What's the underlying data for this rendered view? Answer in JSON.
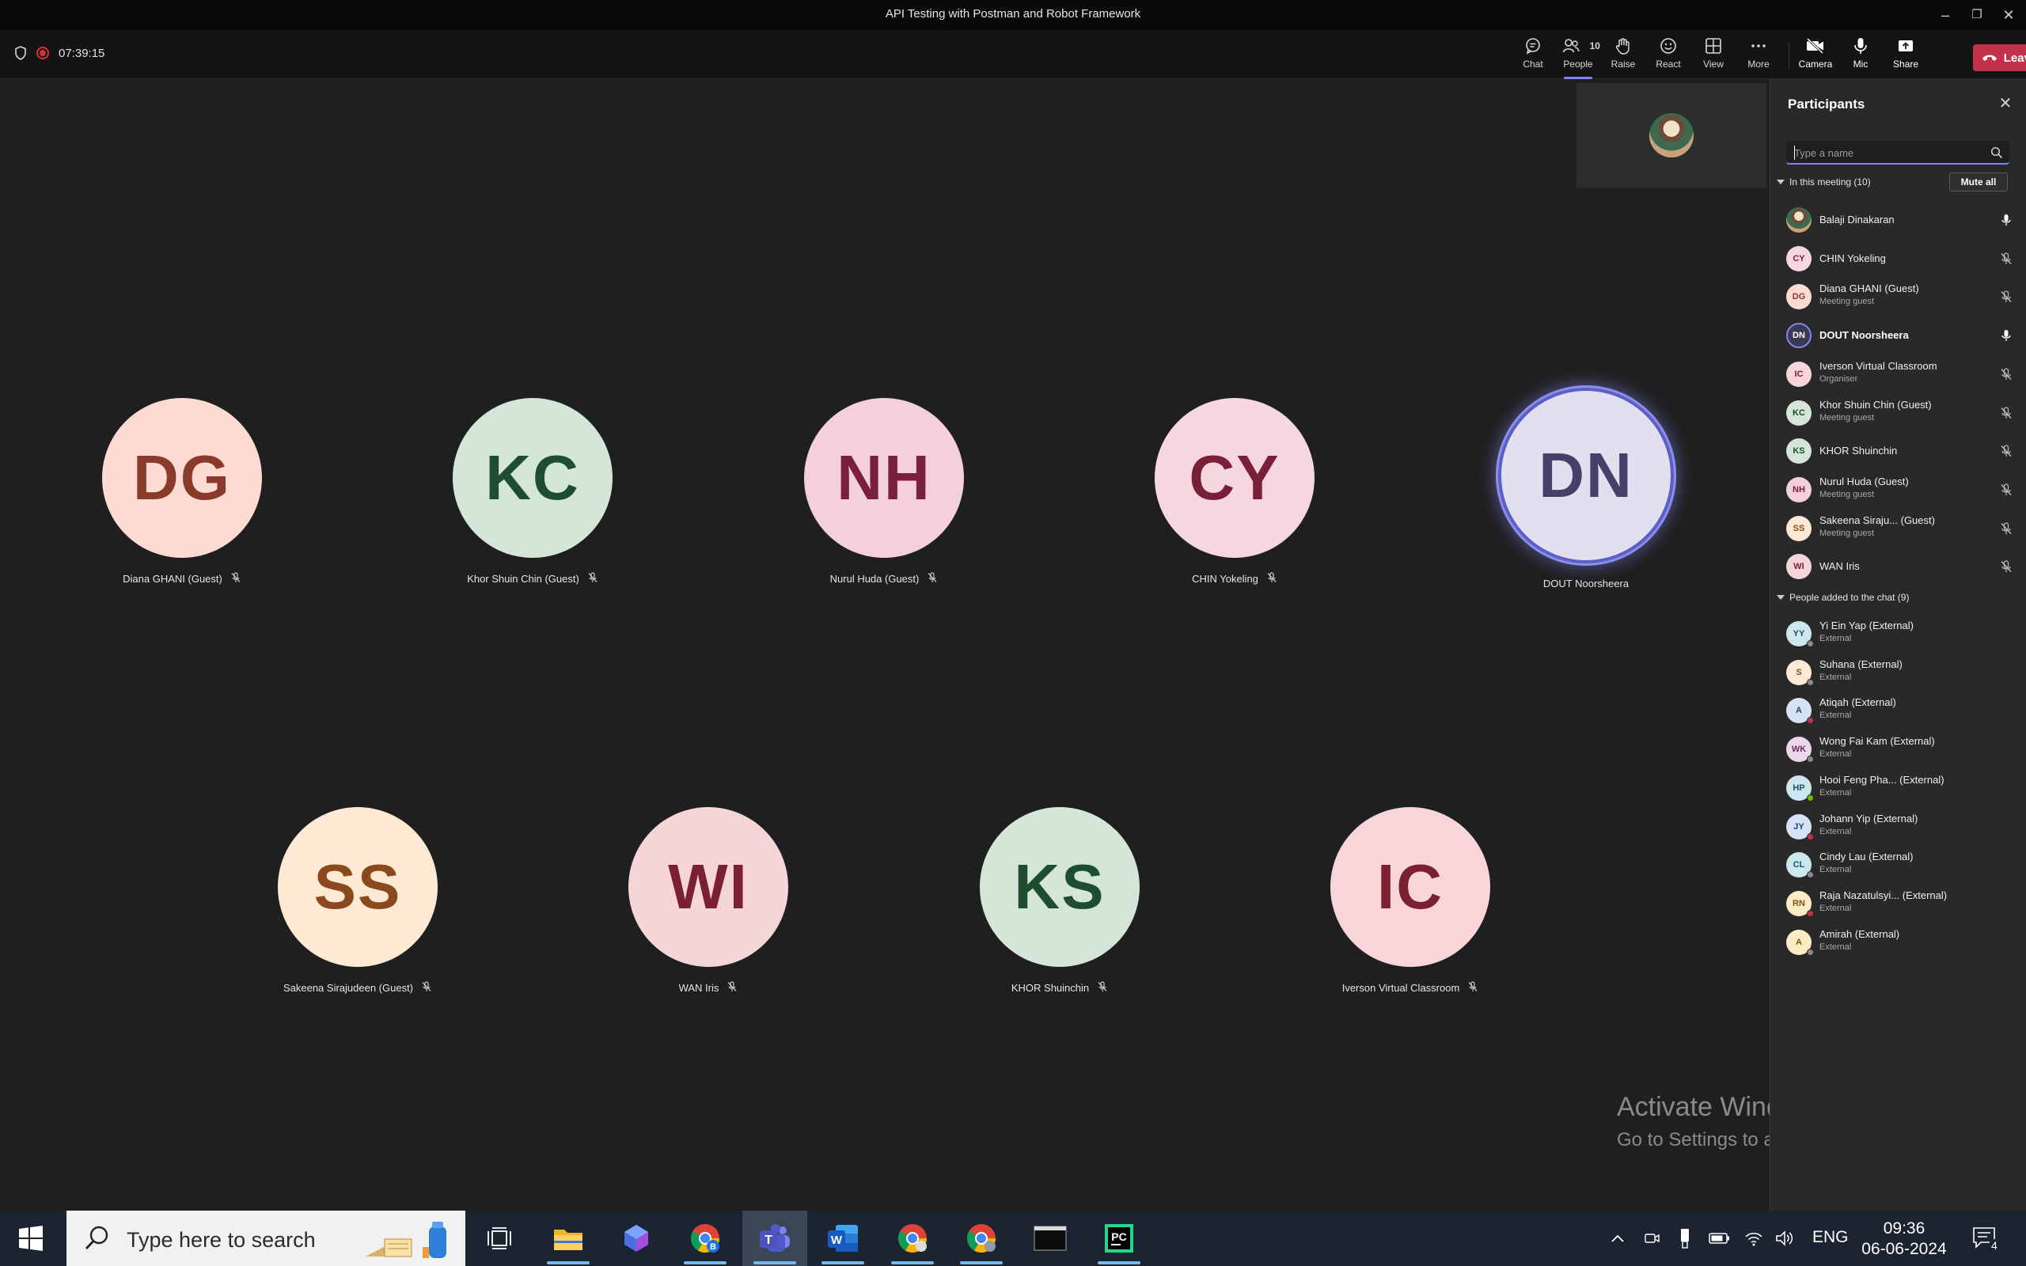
{
  "window": {
    "title": "API Testing with Postman and Robot Framework",
    "controls": [
      "minimize-icon",
      "restore-icon",
      "close-icon"
    ]
  },
  "toolbar": {
    "timer": "07:39:15",
    "buttons": [
      {
        "label": "Chat",
        "icon": "chat-icon"
      },
      {
        "label": "People",
        "icon": "people-icon",
        "badge": "10"
      },
      {
        "label": "Raise",
        "icon": "raise-hand-icon"
      },
      {
        "label": "React",
        "icon": "react-icon"
      },
      {
        "label": "View",
        "icon": "view-icon"
      },
      {
        "label": "More",
        "icon": "more-icon"
      },
      {
        "label": "Camera",
        "icon": "camera-off-icon"
      },
      {
        "label": "Mic",
        "icon": "mic-icon"
      },
      {
        "label": "Share",
        "icon": "share-icon"
      }
    ],
    "leave_label": "Leave"
  },
  "stage": {
    "tiles": [
      {
        "initials": "DG",
        "name": "Diana GHANI (Guest)",
        "bg": "#fddbd2",
        "fg": "#8a3a2a",
        "muted": true
      },
      {
        "initials": "KC",
        "name": "Khor Shuin Chin (Guest)",
        "bg": "#d3e6d8",
        "fg": "#1f4d30",
        "muted": true
      },
      {
        "initials": "NH",
        "name": "Nurul Huda (Guest)",
        "bg": "#f4d0dc",
        "fg": "#7a1f3e",
        "muted": true
      },
      {
        "initials": "CY",
        "name": "CHIN Yokeling",
        "bg": "#f6d6df",
        "fg": "#7a1f3a",
        "muted": true
      },
      {
        "initials": "DN",
        "name": "DOUT Noorsheera",
        "bg": "#e2e0ee",
        "fg": "#44406a",
        "muted": false,
        "speaking": true
      },
      {
        "initials": "SS",
        "name": "Sakeena Sirajudeen (Guest)",
        "bg": "#fde9d4",
        "fg": "#8a4a1e",
        "muted": true
      },
      {
        "initials": "WI",
        "name": "WAN Iris",
        "bg": "#f5d5d8",
        "fg": "#7a2030",
        "muted": true
      },
      {
        "initials": "KS",
        "name": "KHOR Shuinchin",
        "bg": "#d3e6d8",
        "fg": "#1f4d30",
        "muted": true
      },
      {
        "initials": "IC",
        "name": "Iverson Virtual Classroom",
        "bg": "#f7d5d8",
        "fg": "#7a2030",
        "muted": true
      }
    ]
  },
  "panel": {
    "title": "Participants",
    "search_placeholder": "Type a name",
    "mute_all_label": "Mute all",
    "in_meeting_header": "In this meeting (10)",
    "in_meeting": [
      {
        "initials": "",
        "name": "Balaji Dinakaran",
        "sub": "",
        "photo": true,
        "mic": "on"
      },
      {
        "initials": "CY",
        "name": "CHIN Yokeling",
        "sub": "",
        "bg": "#f6d6df",
        "fg": "#7a1f3a",
        "mic": "off"
      },
      {
        "initials": "DG",
        "name": "Diana GHANI (Guest)",
        "sub": "Meeting guest",
        "bg": "#fddbd2",
        "fg": "#8a3a2a",
        "mic": "off"
      },
      {
        "initials": "DN",
        "name": "DOUT Noorsheera",
        "sub": "",
        "bg": "#3a3a55",
        "fg": "#ffffff",
        "mic": "on",
        "speaking": true
      },
      {
        "initials": "IC",
        "name": "Iverson Virtual Classroom",
        "sub": "Organiser",
        "bg": "#f7d5d8",
        "fg": "#7a2030",
        "mic": "off"
      },
      {
        "initials": "KC",
        "name": "Khor Shuin Chin (Guest)",
        "sub": "Meeting guest",
        "bg": "#d3e6d8",
        "fg": "#1f4d30",
        "mic": "off"
      },
      {
        "initials": "KS",
        "name": "KHOR Shuinchin",
        "sub": "",
        "bg": "#d3e6d8",
        "fg": "#1f4d30",
        "mic": "off"
      },
      {
        "initials": "NH",
        "name": "Nurul Huda (Guest)",
        "sub": "Meeting guest",
        "bg": "#f4d0dc",
        "fg": "#7a1f3e",
        "mic": "off"
      },
      {
        "initials": "SS",
        "name": "Sakeena Siraju... (Guest)",
        "sub": "Meeting guest",
        "bg": "#fde9d4",
        "fg": "#8a4a1e",
        "mic": "off"
      },
      {
        "initials": "WI",
        "name": "WAN Iris",
        "sub": "",
        "bg": "#f5d5d8",
        "fg": "#7a2030",
        "mic": "off"
      }
    ],
    "added_header": "People added to the chat (9)",
    "added": [
      {
        "initials": "YY",
        "name": "Yi Ein Yap (External)",
        "sub": "External",
        "bg": "#cde7ee",
        "fg": "#1d5566",
        "status": "#8a8a8a"
      },
      {
        "initials": "S",
        "name": "Suhana (External)",
        "sub": "External",
        "bg": "#fde9d4",
        "fg": "#8a4a1e",
        "status": "#8a8a8a"
      },
      {
        "initials": "A",
        "name": "Atiqah (External)",
        "sub": "External",
        "bg": "#d6e2f5",
        "fg": "#25437a",
        "status": "#c4314b"
      },
      {
        "initials": "WK",
        "name": "Wong Fai Kam (External)",
        "sub": "External",
        "bg": "#ecd8ea",
        "fg": "#6a2a66",
        "status": "#8a8a8a"
      },
      {
        "initials": "HP",
        "name": "Hooi Feng Pha... (External)",
        "sub": "External",
        "bg": "#cde7ee",
        "fg": "#1d5566",
        "status": "#6bb700"
      },
      {
        "initials": "JY",
        "name": "Johann Yip (External)",
        "sub": "External",
        "bg": "#d6e2f5",
        "fg": "#25437a",
        "status": "#c4314b"
      },
      {
        "initials": "CL",
        "name": "Cindy Lau (External)",
        "sub": "External",
        "bg": "#cde7ee",
        "fg": "#1d5566",
        "status": "#8a8a8a"
      },
      {
        "initials": "RN",
        "name": "Raja Nazatulsyi... (External)",
        "sub": "External",
        "bg": "#fdebc6",
        "fg": "#7a5510",
        "status": "#c4314b"
      },
      {
        "initials": "A",
        "name": "Amirah (External)",
        "sub": "External",
        "bg": "#fdebc6",
        "fg": "#7a5510",
        "status": "#8a8a8a"
      }
    ]
  },
  "watermark": {
    "line1": "Activate Windows",
    "line2": "Go to Settings to activate Windows."
  },
  "taskbar": {
    "search_placeholder": "Type here to search",
    "apps": [
      "task-view-icon",
      "file-explorer-icon",
      "copilot-icon",
      "chrome-b-icon",
      "teams-icon",
      "word-icon",
      "chrome-icon",
      "chrome-profile-icon",
      "terminal-icon",
      "pycharm-icon"
    ],
    "language": "ENG",
    "time": "09:36",
    "date": "06-06-2024",
    "notification_count": "4"
  }
}
